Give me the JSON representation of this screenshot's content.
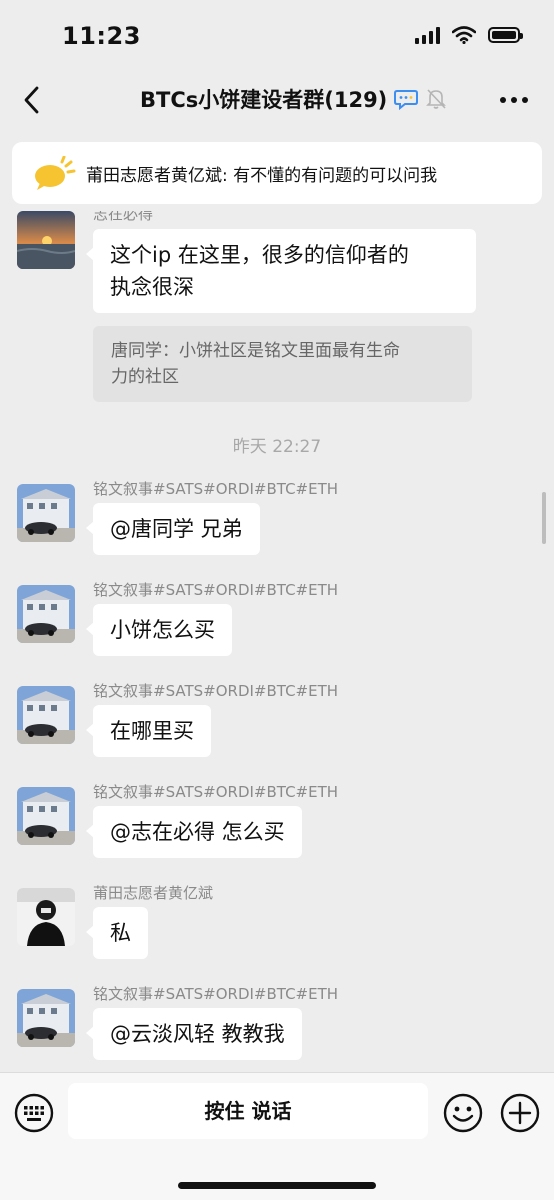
{
  "status": {
    "time": "11:23"
  },
  "header": {
    "title": "BTCs小饼建设者群(129)"
  },
  "pinned": {
    "text": "莆田志愿者黄亿斌: 有不懂的有问题的可以问我"
  },
  "messages": {
    "first": {
      "sender": "志在必得",
      "text_line1": "这个ip 在这里，很多的信仰者的",
      "text_line2": "执念很深",
      "quote_line1": "唐同学：小饼社区是铭文里面最有生命",
      "quote_line2": "力的社区"
    },
    "timestamp": "昨天 22:27",
    "list": [
      {
        "sender": "铭文叙事#SATS#ORDI#BTC#ETH",
        "text": "@唐同学 兄弟"
      },
      {
        "sender": "铭文叙事#SATS#ORDI#BTC#ETH",
        "text": "小饼怎么买"
      },
      {
        "sender": "铭文叙事#SATS#ORDI#BTC#ETH",
        "text": "在哪里买"
      },
      {
        "sender": "铭文叙事#SATS#ORDI#BTC#ETH",
        "text": "@志在必得 怎么买"
      },
      {
        "sender": "莆田志愿者黄亿斌",
        "text": "私"
      },
      {
        "sender": "铭文叙事#SATS#ORDI#BTC#ETH",
        "text": "@云淡风轻 教教我"
      }
    ]
  },
  "input": {
    "talk_label": "按住 说话"
  },
  "icons": {
    "back": "chevron-left-icon",
    "group_chat": "chat-bubble-icon",
    "muted": "bell-slash-icon",
    "more": "more-dots-icon",
    "keyboard": "keyboard-icon",
    "emoji": "emoji-icon",
    "plus": "plus-icon"
  },
  "colors": {
    "background": "#ededed",
    "bubble": "#ffffff",
    "accent_blue": "#3c8ef0",
    "bulb_yellow": "#f6c431"
  }
}
